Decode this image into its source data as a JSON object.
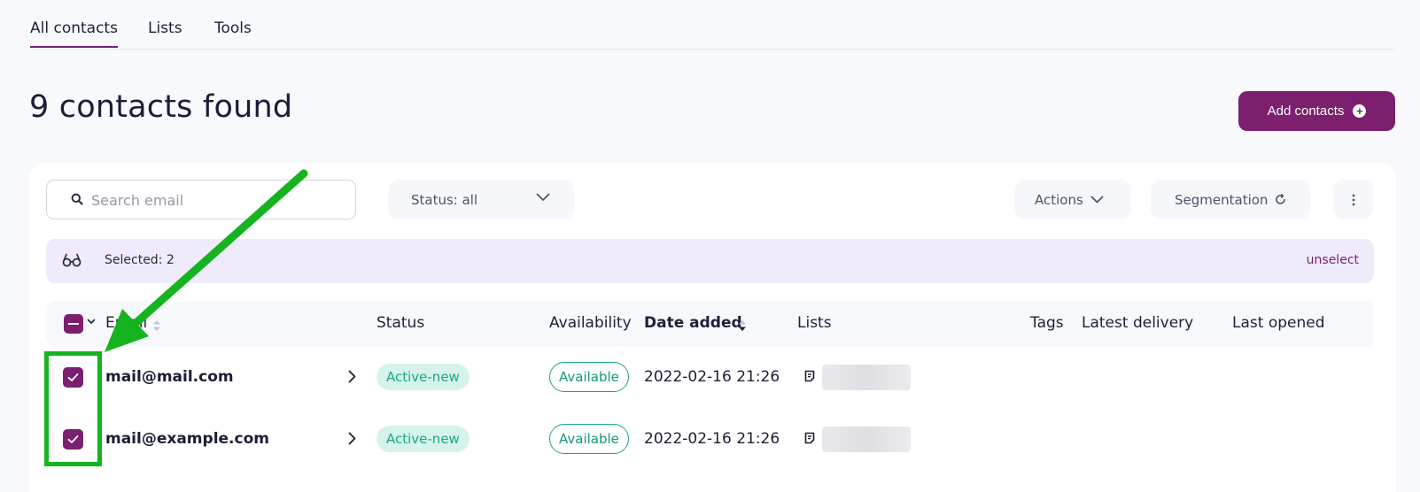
{
  "tabs": [
    {
      "label": "All contacts",
      "active": true
    },
    {
      "label": "Lists",
      "active": false
    },
    {
      "label": "Tools",
      "active": false
    }
  ],
  "header": {
    "title": "9 contacts found",
    "add_button_label": "Add contacts"
  },
  "toolbar": {
    "search_placeholder": "Search email",
    "search_value": "",
    "status_filter_label": "Status: all",
    "actions_label": "Actions",
    "segmentation_label": "Segmentation"
  },
  "selection": {
    "label": "Selected: 2",
    "unselect_label": "unselect"
  },
  "table": {
    "columns": [
      "Email",
      "Status",
      "Availability",
      "Date added",
      "Lists",
      "Tags",
      "Latest delivery",
      "Last opened"
    ],
    "rows": [
      {
        "email": "mail@mail.com",
        "status": "Active-new",
        "availability": "Available",
        "date_added": "2022-02-16 21:26",
        "selected": true
      },
      {
        "email": "mail@example.com",
        "status": "Active-new",
        "availability": "Available",
        "date_added": "2022-02-16 21:26",
        "selected": true
      }
    ]
  },
  "colors": {
    "brand": "#7b1f6e",
    "status_badge_bg": "#d5f3ea",
    "status_badge_text": "#18a88a",
    "selection_bar_bg": "#f0ebfa",
    "annotation_green": "#15b31f"
  },
  "icons": [
    "search-icon",
    "chevron-down-icon",
    "refresh-icon",
    "more-vertical-icon",
    "glasses-icon",
    "plus-circle-icon",
    "check-icon",
    "chevron-right-icon",
    "list-icon",
    "sort-icon"
  ]
}
